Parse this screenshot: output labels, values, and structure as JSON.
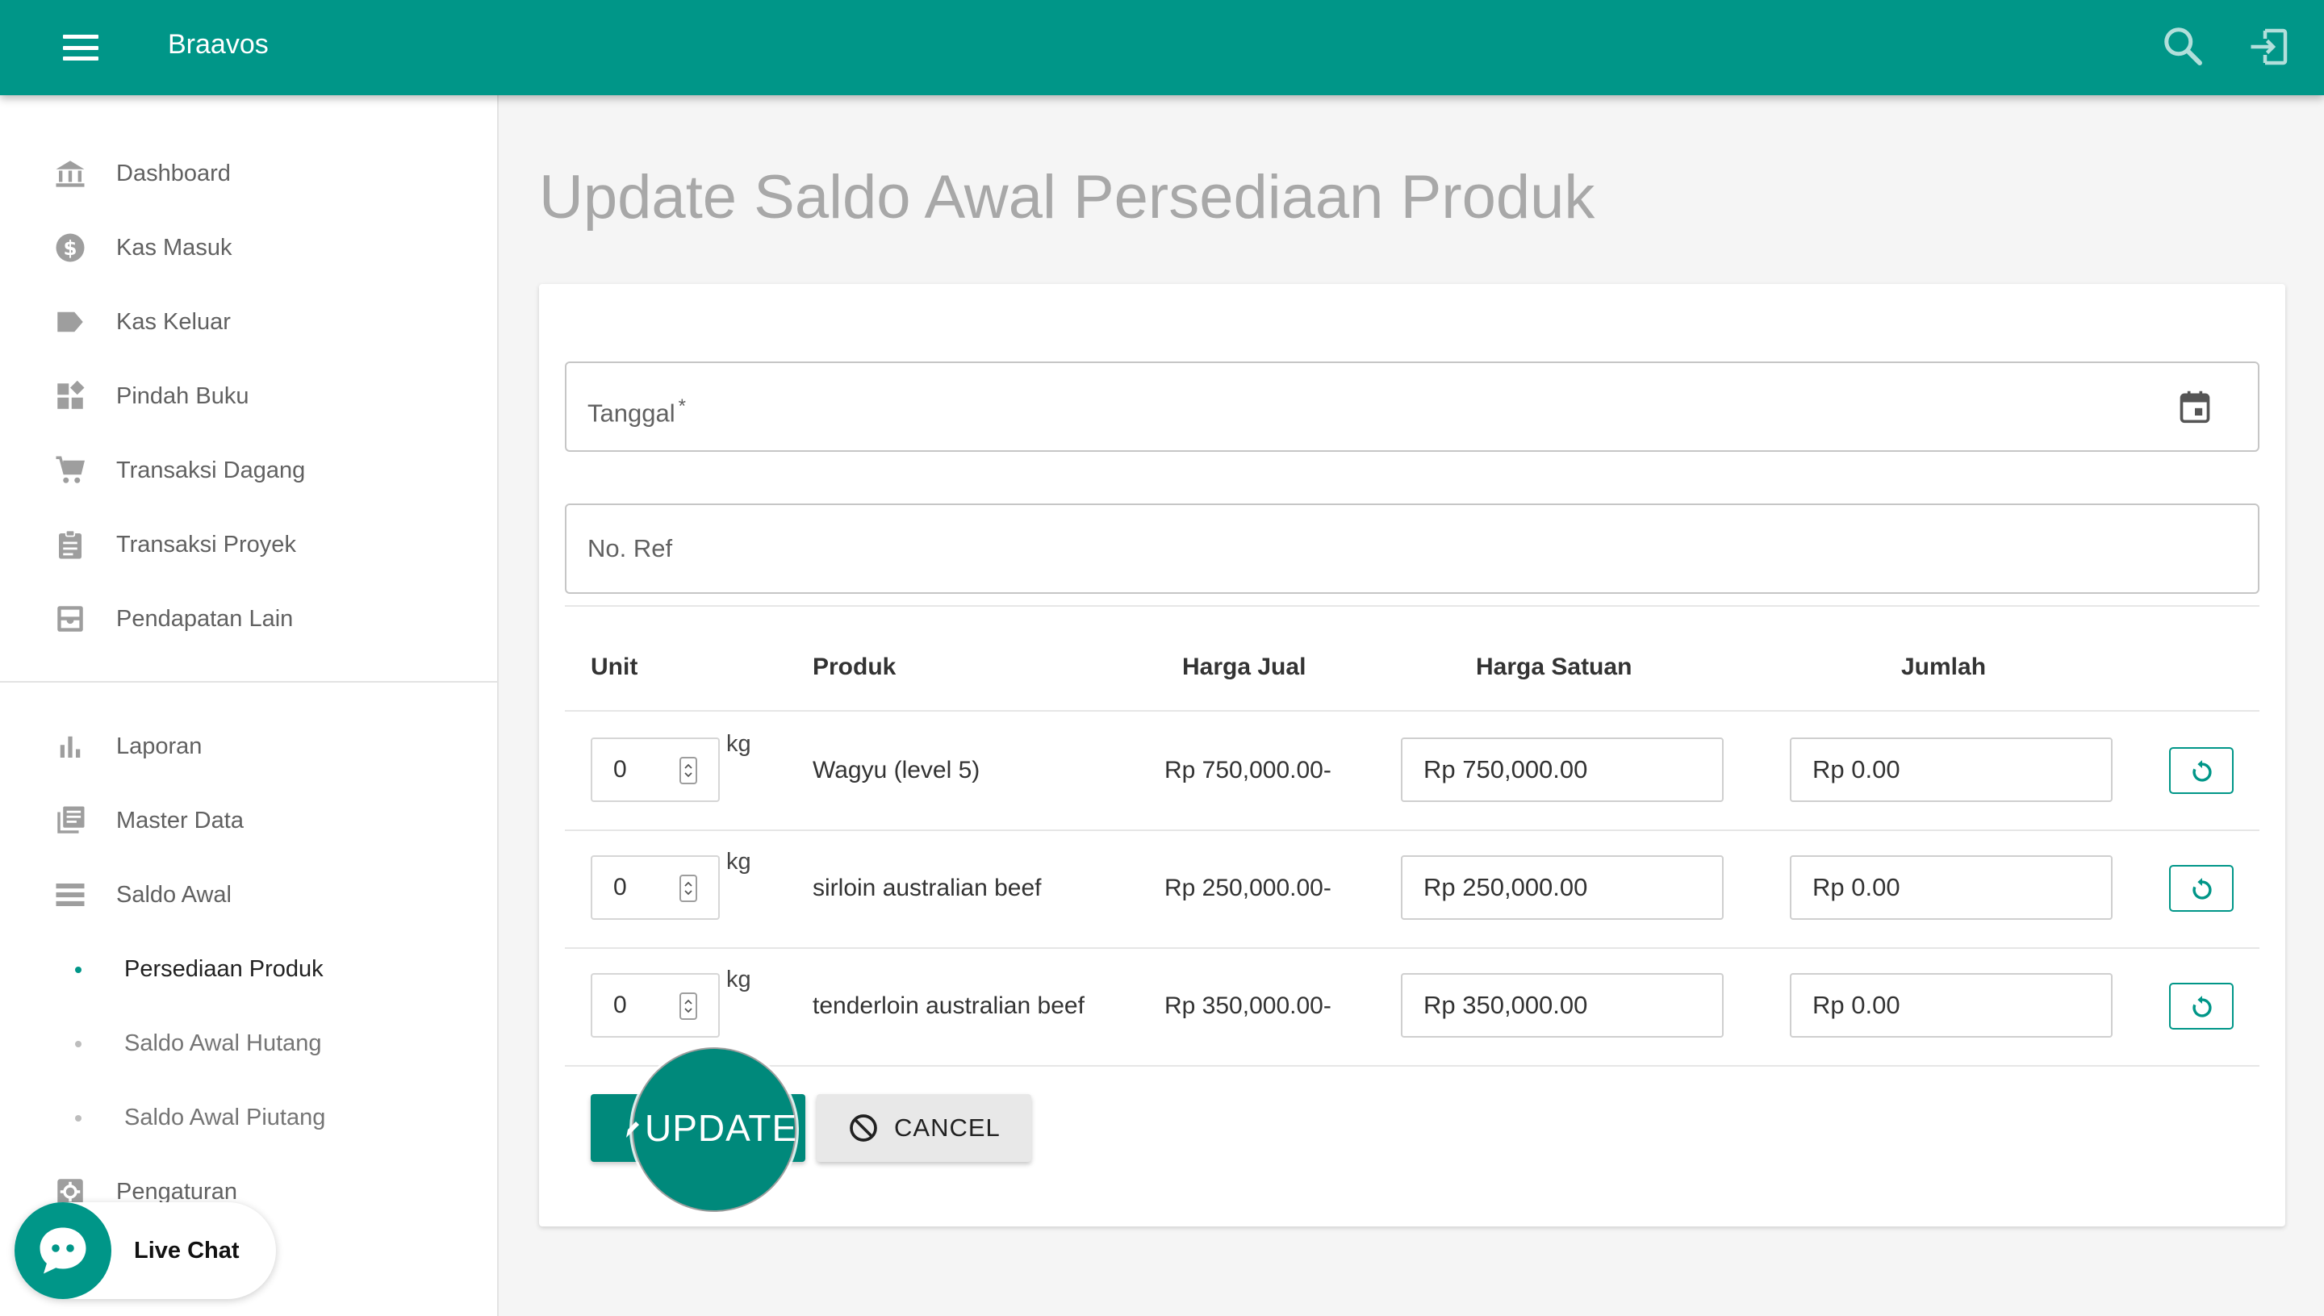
{
  "app": {
    "title": "Braavos"
  },
  "sidebar": {
    "items": [
      {
        "label": "Dashboard",
        "icon": "bank-icon"
      },
      {
        "label": "Kas Masuk",
        "icon": "dollar-circle-icon"
      },
      {
        "label": "Kas Keluar",
        "icon": "label-icon"
      },
      {
        "label": "Pindah Buku",
        "icon": "widgets-icon"
      },
      {
        "label": "Transaksi Dagang",
        "icon": "cart-icon"
      },
      {
        "label": "Transaksi Proyek",
        "icon": "clipboard-icon"
      },
      {
        "label": "Pendapatan Lain",
        "icon": "inbox-icon"
      }
    ],
    "items2": [
      {
        "label": "Laporan",
        "icon": "bar-chart-icon"
      },
      {
        "label": "Master Data",
        "icon": "library-books-icon"
      },
      {
        "label": "Saldo Awal",
        "icon": "list-icon"
      }
    ],
    "subitems": [
      {
        "label": "Persediaan Produk",
        "active": true
      },
      {
        "label": "Saldo Awal Hutang",
        "active": false
      },
      {
        "label": "Saldo Awal Piutang",
        "active": false
      }
    ],
    "settings": {
      "label": "Pengaturan",
      "icon": "gear-icon"
    }
  },
  "page": {
    "title": "Update Saldo Awal Persediaan Produk"
  },
  "form": {
    "tanggal_label": "Tanggal",
    "required_mark": "*",
    "noref_label": "No. Ref"
  },
  "table": {
    "headers": [
      "Unit",
      "Produk",
      "Harga Jual",
      "Harga Satuan",
      "Jumlah"
    ],
    "rows": [
      {
        "unit": "0",
        "unit_label": "kg",
        "produk": "Wagyu (level 5)",
        "harga_jual": "Rp 750,000.00-",
        "harga_satuan": "Rp 750,000.00",
        "jumlah": "Rp 0.00"
      },
      {
        "unit": "0",
        "unit_label": "kg",
        "produk": "sirloin australian beef",
        "harga_jual": "Rp 250,000.00-",
        "harga_satuan": "Rp 250,000.00",
        "jumlah": "Rp 0.00"
      },
      {
        "unit": "0",
        "unit_label": "kg",
        "produk": "tenderloin australian beef",
        "harga_jual": "Rp 350,000.00-",
        "harga_satuan": "Rp 350,000.00",
        "jumlah": "Rp 0.00"
      }
    ]
  },
  "actions": {
    "update_label": "UPDATE",
    "cancel_label": "CANCEL"
  },
  "chat": {
    "label": "Live Chat"
  },
  "colors": {
    "primary": "#009688",
    "button": "#00897b"
  }
}
